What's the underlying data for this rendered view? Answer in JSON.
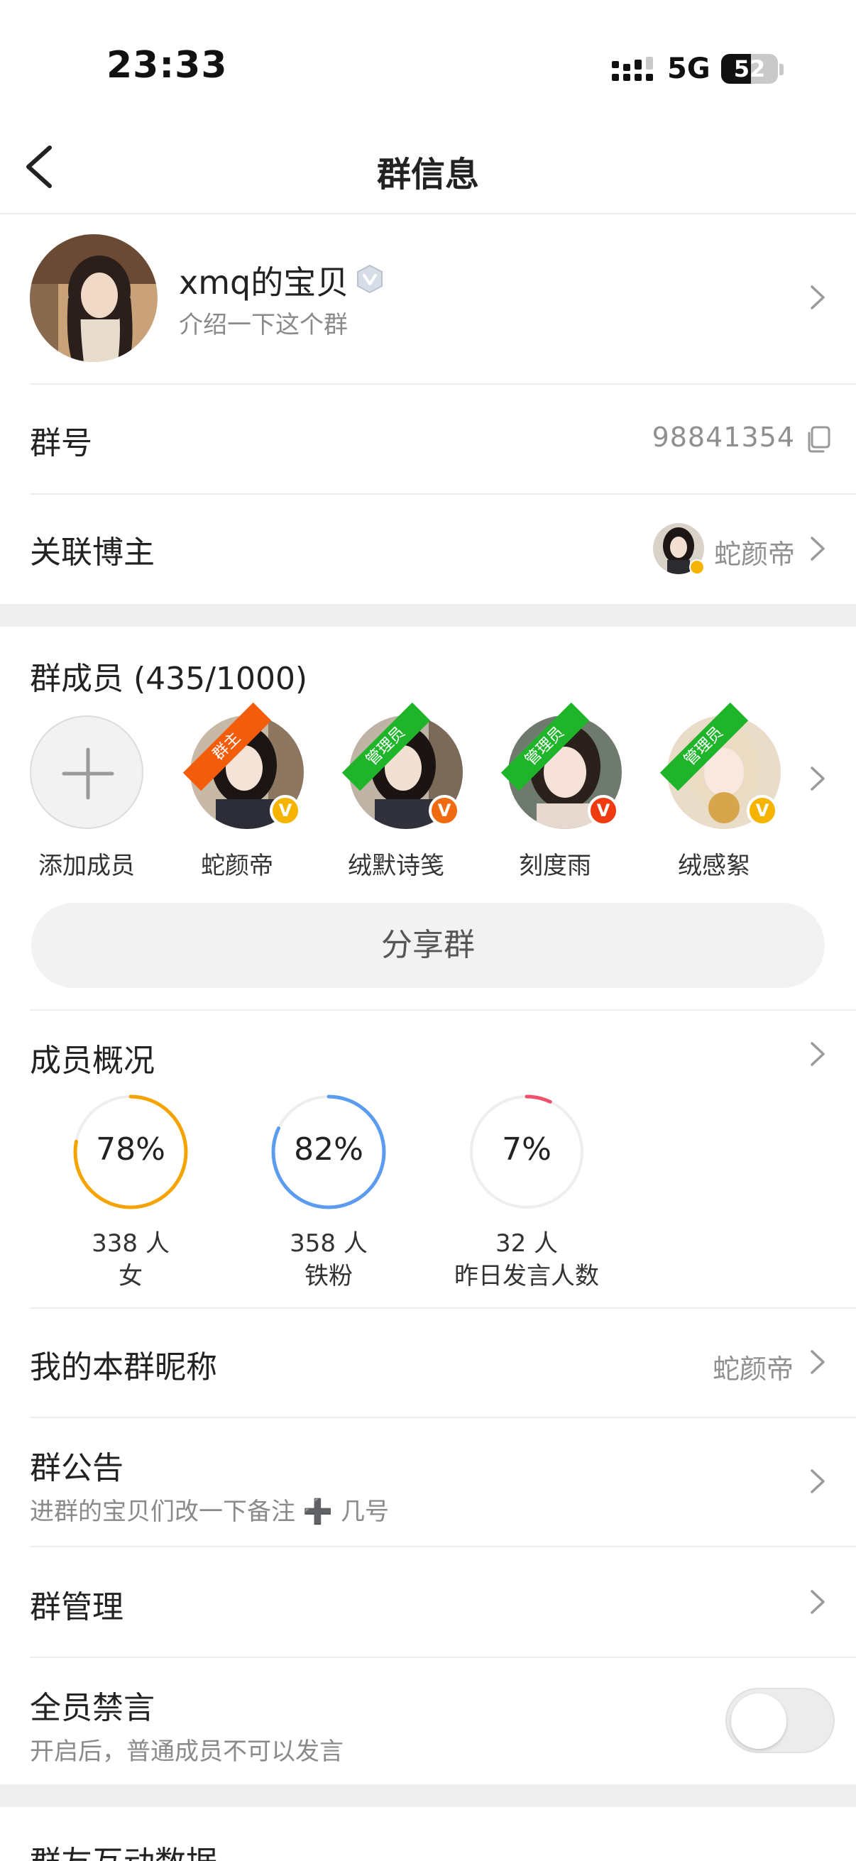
{
  "status_bar": {
    "time": "23:33",
    "network": "5G",
    "battery": "52",
    "battery_level": 0.52
  },
  "nav": {
    "title": "群信息"
  },
  "group": {
    "name": "xmq的宝贝",
    "description": "介绍一下这个群",
    "id_label": "群号",
    "id_value": "98841354",
    "blogger_label": "关联博主",
    "blogger_name": "蛇颜帝"
  },
  "members": {
    "title": "群成员 (435/1000)",
    "add_label": "添加成员",
    "list": [
      {
        "name": "蛇颜帝",
        "role": "群主",
        "role_color": "#f25c0a",
        "badge": "V",
        "badge_color": "#f6b400"
      },
      {
        "name": "绒默诗笺",
        "role": "管理员",
        "role_color": "#1fb52b",
        "badge": "V",
        "badge_color": "#f06a10"
      },
      {
        "name": "刻度雨",
        "role": "管理员",
        "role_color": "#1fb52b",
        "badge": "V",
        "badge_color": "#f03a10"
      },
      {
        "name": "绒感絮",
        "role": "管理员",
        "role_color": "#1fb52b",
        "badge": "V",
        "badge_color": "#f6b400"
      }
    ],
    "share_label": "分享群"
  },
  "overview": {
    "title": "成员概况",
    "stats": [
      {
        "percent_text": "78%",
        "percent": 78,
        "count": "338 人",
        "label": "女",
        "color": "#f5a300"
      },
      {
        "percent_text": "82%",
        "percent": 82,
        "count": "358 人",
        "label": "铁粉",
        "color": "#5b9bf0"
      },
      {
        "percent_text": "7%",
        "percent": 7,
        "count": "32 人",
        "label": "昨日发言人数",
        "color": "#f0506a"
      }
    ]
  },
  "settings": {
    "nickname_label": "我的本群昵称",
    "nickname_value": "蛇颜帝",
    "notice_label": "群公告",
    "notice_text": "进群的宝贝们改一下备注 ➕ 几号",
    "manage_label": "群管理",
    "mute_label": "全员禁言",
    "mute_desc": "开启后，普通成员不可以发言",
    "mute_on": false,
    "interaction_label": "群友互动数据"
  }
}
